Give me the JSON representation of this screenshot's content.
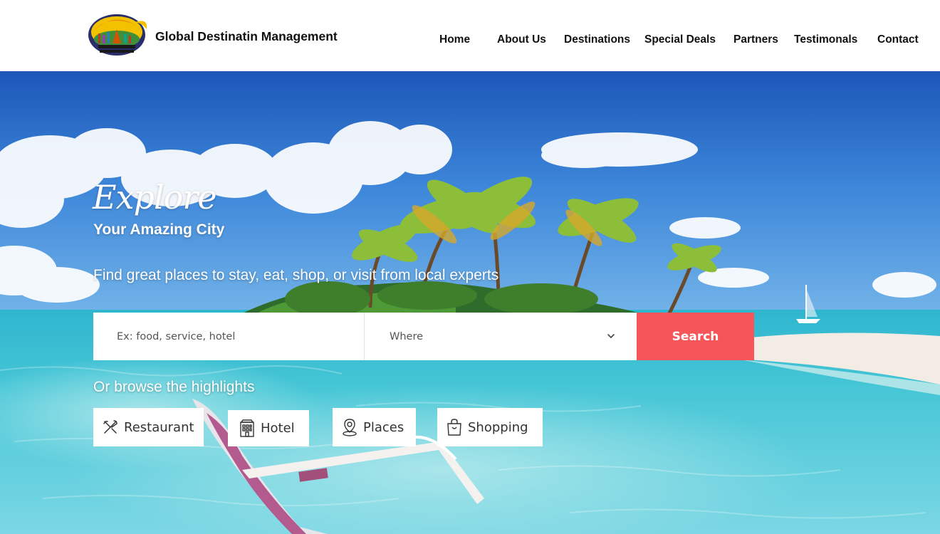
{
  "header": {
    "brand": "Global Destinatin Management",
    "nav": [
      "Home",
      "About Us",
      "Destinations",
      "Special Deals",
      "Partners",
      "Testimonals",
      "Contact"
    ]
  },
  "hero": {
    "explore": "Explore",
    "subtitle": "Your Amazing City",
    "tagline": "Find great places to stay, eat, shop, or visit from local experts",
    "search": {
      "placeholder": "Ex: food, service, hotel",
      "where": "Where",
      "button": "Search"
    },
    "browse_label": "Or browse the highlights",
    "categories": [
      {
        "label": "Restaurant",
        "icon": "restaurant-icon"
      },
      {
        "label": "Hotel",
        "icon": "hotel-icon"
      },
      {
        "label": "Places",
        "icon": "location-pin-icon"
      },
      {
        "label": "Shopping",
        "icon": "shopping-bag-icon"
      }
    ]
  },
  "colors": {
    "accent": "#f6555a",
    "header_bg": "#ffffff",
    "text_dark": "#111111"
  }
}
